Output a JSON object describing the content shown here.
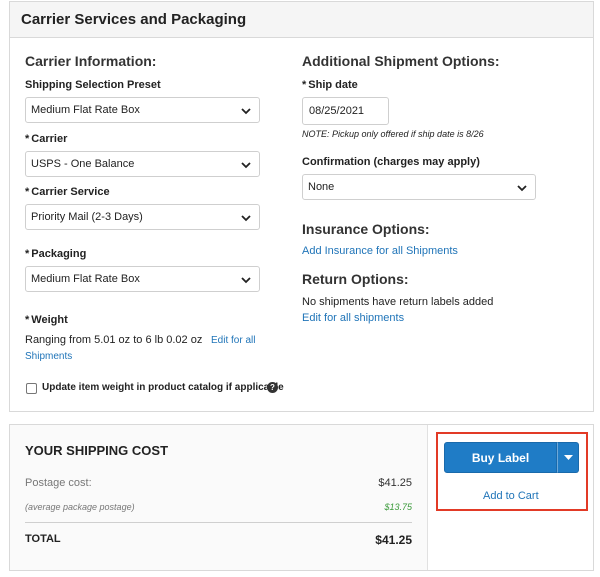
{
  "panel": {
    "title": "Carrier Services and Packaging"
  },
  "carrier_info": {
    "title": "Carrier Information:",
    "preset": {
      "label": "Shipping Selection Preset",
      "value": "Medium Flat Rate Box"
    },
    "carrier": {
      "required_mark": "*",
      "label": "Carrier",
      "value": "USPS - One Balance"
    },
    "service": {
      "required_mark": "*",
      "label": "Carrier Service",
      "value": "Priority Mail (2-3 Days)"
    },
    "packaging": {
      "required_mark": "*",
      "label": "Packaging",
      "value": "Medium Flat Rate Box"
    },
    "weight": {
      "required_mark": "*",
      "label": "Weight",
      "range_text": "Ranging from 5.01 oz to 6 lb 0.02 oz",
      "edit_link_1": "Edit for all",
      "edit_link_2": "Shipments"
    },
    "update_weight_label": "Update item weight in product catalog if applicable",
    "help_glyph": "?"
  },
  "additional": {
    "title": "Additional Shipment Options:",
    "ship_date": {
      "required_mark": "*",
      "label": "Ship date",
      "value": "08/25/2021",
      "note": "NOTE: Pickup only offered if ship date is 8/26"
    },
    "confirmation": {
      "label": "Confirmation (charges may apply)",
      "value": "None"
    },
    "insurance": {
      "title": "Insurance Options:",
      "link": "Add Insurance for all Shipments"
    },
    "return": {
      "title": "Return Options:",
      "text": "No shipments have return labels added",
      "link": "Edit for all shipments"
    }
  },
  "shipping_cost": {
    "title": "YOUR SHIPPING COST",
    "postage_label": "Postage cost:",
    "postage_value": "$41.25",
    "average_label": "(average package postage)",
    "average_value": "$13.75",
    "total_label": "TOTAL",
    "total_value": "$41.25"
  },
  "actions": {
    "buy_label": "Buy Label",
    "add_to_cart": "Add to Cart"
  },
  "colors": {
    "link": "#1f74b8",
    "button": "#1f7cc6",
    "highlight": "#e23a26",
    "green_text": "#3a9a3a"
  },
  "icons": {
    "select_chevron": "chevron-down-icon",
    "caret": "caret-down-icon",
    "help": "question-circle-icon"
  }
}
